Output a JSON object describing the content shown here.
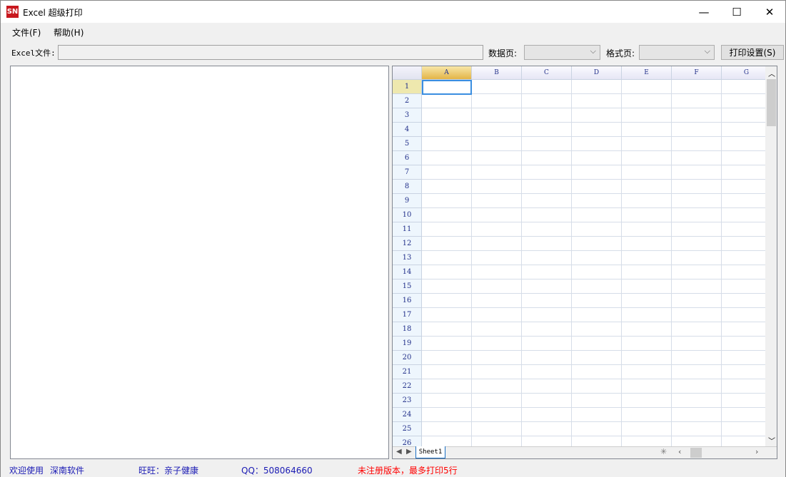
{
  "window": {
    "logo": "SN",
    "title": "Excel 超级打印",
    "min": "—",
    "max": "☐",
    "close": "✕"
  },
  "menu": [
    "文件(F)",
    "帮助(H)"
  ],
  "toolbar": {
    "file_label": "Excel文件:",
    "file_value": "",
    "data_label": "数据页:",
    "data_value": "",
    "format_label": "格式页:",
    "format_value": "",
    "print_settings": "打印设置(S)"
  },
  "grid": {
    "columns": [
      "A",
      "B",
      "C",
      "D",
      "E",
      "F",
      "G"
    ],
    "rows": [
      "1",
      "2",
      "3",
      "4",
      "5",
      "6",
      "7",
      "8",
      "9",
      "10",
      "11",
      "12",
      "13",
      "14",
      "15",
      "16",
      "17",
      "18",
      "19",
      "20",
      "21",
      "22",
      "23",
      "24",
      "25",
      "26"
    ],
    "selected_cell": "A1",
    "sheet_tab": "Sheet1"
  },
  "status": {
    "welcome": "欢迎使用",
    "company": "深南软件",
    "wangwang": "旺旺：亲子健康",
    "qq": "QQ：508064660",
    "license": "未注册版本，最多打印5行"
  },
  "colors": {
    "selection": "#3a8ee0",
    "license_text": "#ff0000",
    "status_text": "#1a1ab4"
  }
}
